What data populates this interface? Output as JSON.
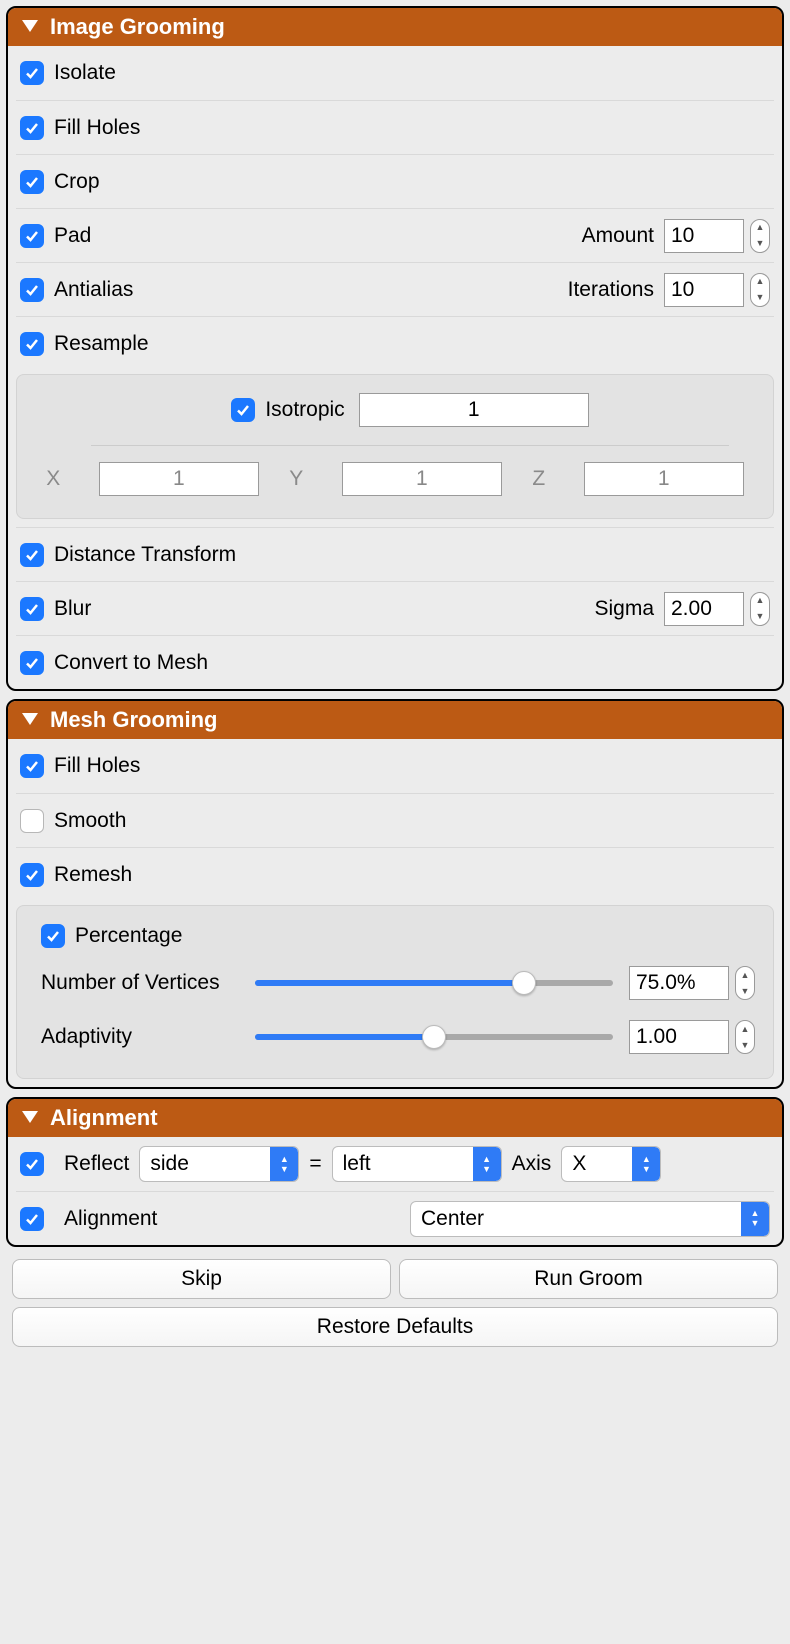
{
  "panels": {
    "image": {
      "title": "Image Grooming",
      "isolate": {
        "label": "Isolate",
        "checked": true
      },
      "fill_holes": {
        "label": "Fill Holes",
        "checked": true
      },
      "crop": {
        "label": "Crop",
        "checked": true
      },
      "pad": {
        "label": "Pad",
        "checked": true,
        "param_label": "Amount",
        "value": "10"
      },
      "antialias": {
        "label": "Antialias",
        "checked": true,
        "param_label": "Iterations",
        "value": "10"
      },
      "resample": {
        "label": "Resample",
        "checked": true,
        "isotropic": {
          "label": "Isotropic",
          "checked": true,
          "value": "1"
        },
        "x": {
          "label": "X",
          "value": "1"
        },
        "y": {
          "label": "Y",
          "value": "1"
        },
        "z": {
          "label": "Z",
          "value": "1"
        }
      },
      "distance_transform": {
        "label": "Distance Transform",
        "checked": true
      },
      "blur": {
        "label": "Blur",
        "checked": true,
        "param_label": "Sigma",
        "value": "2.00"
      },
      "convert_to_mesh": {
        "label": "Convert to Mesh",
        "checked": true
      }
    },
    "mesh": {
      "title": "Mesh Grooming",
      "fill_holes": {
        "label": "Fill Holes",
        "checked": true
      },
      "smooth": {
        "label": "Smooth",
        "checked": false
      },
      "remesh": {
        "label": "Remesh",
        "checked": true,
        "percentage": {
          "label": "Percentage",
          "checked": true
        },
        "vertices": {
          "label": "Number of Vertices",
          "value": "75.0%",
          "slider_pct": 75
        },
        "adaptivity": {
          "label": "Adaptivity",
          "value": "1.00",
          "slider_pct": 50
        }
      }
    },
    "alignment": {
      "title": "Alignment",
      "reflect": {
        "label": "Reflect",
        "checked": true,
        "sel1": "side",
        "eq": "=",
        "sel2": "left",
        "axis_label": "Axis",
        "axis": "X"
      },
      "align": {
        "label": "Alignment",
        "checked": true,
        "value": "Center"
      }
    }
  },
  "buttons": {
    "skip": "Skip",
    "run": "Run Groom",
    "restore": "Restore Defaults"
  }
}
